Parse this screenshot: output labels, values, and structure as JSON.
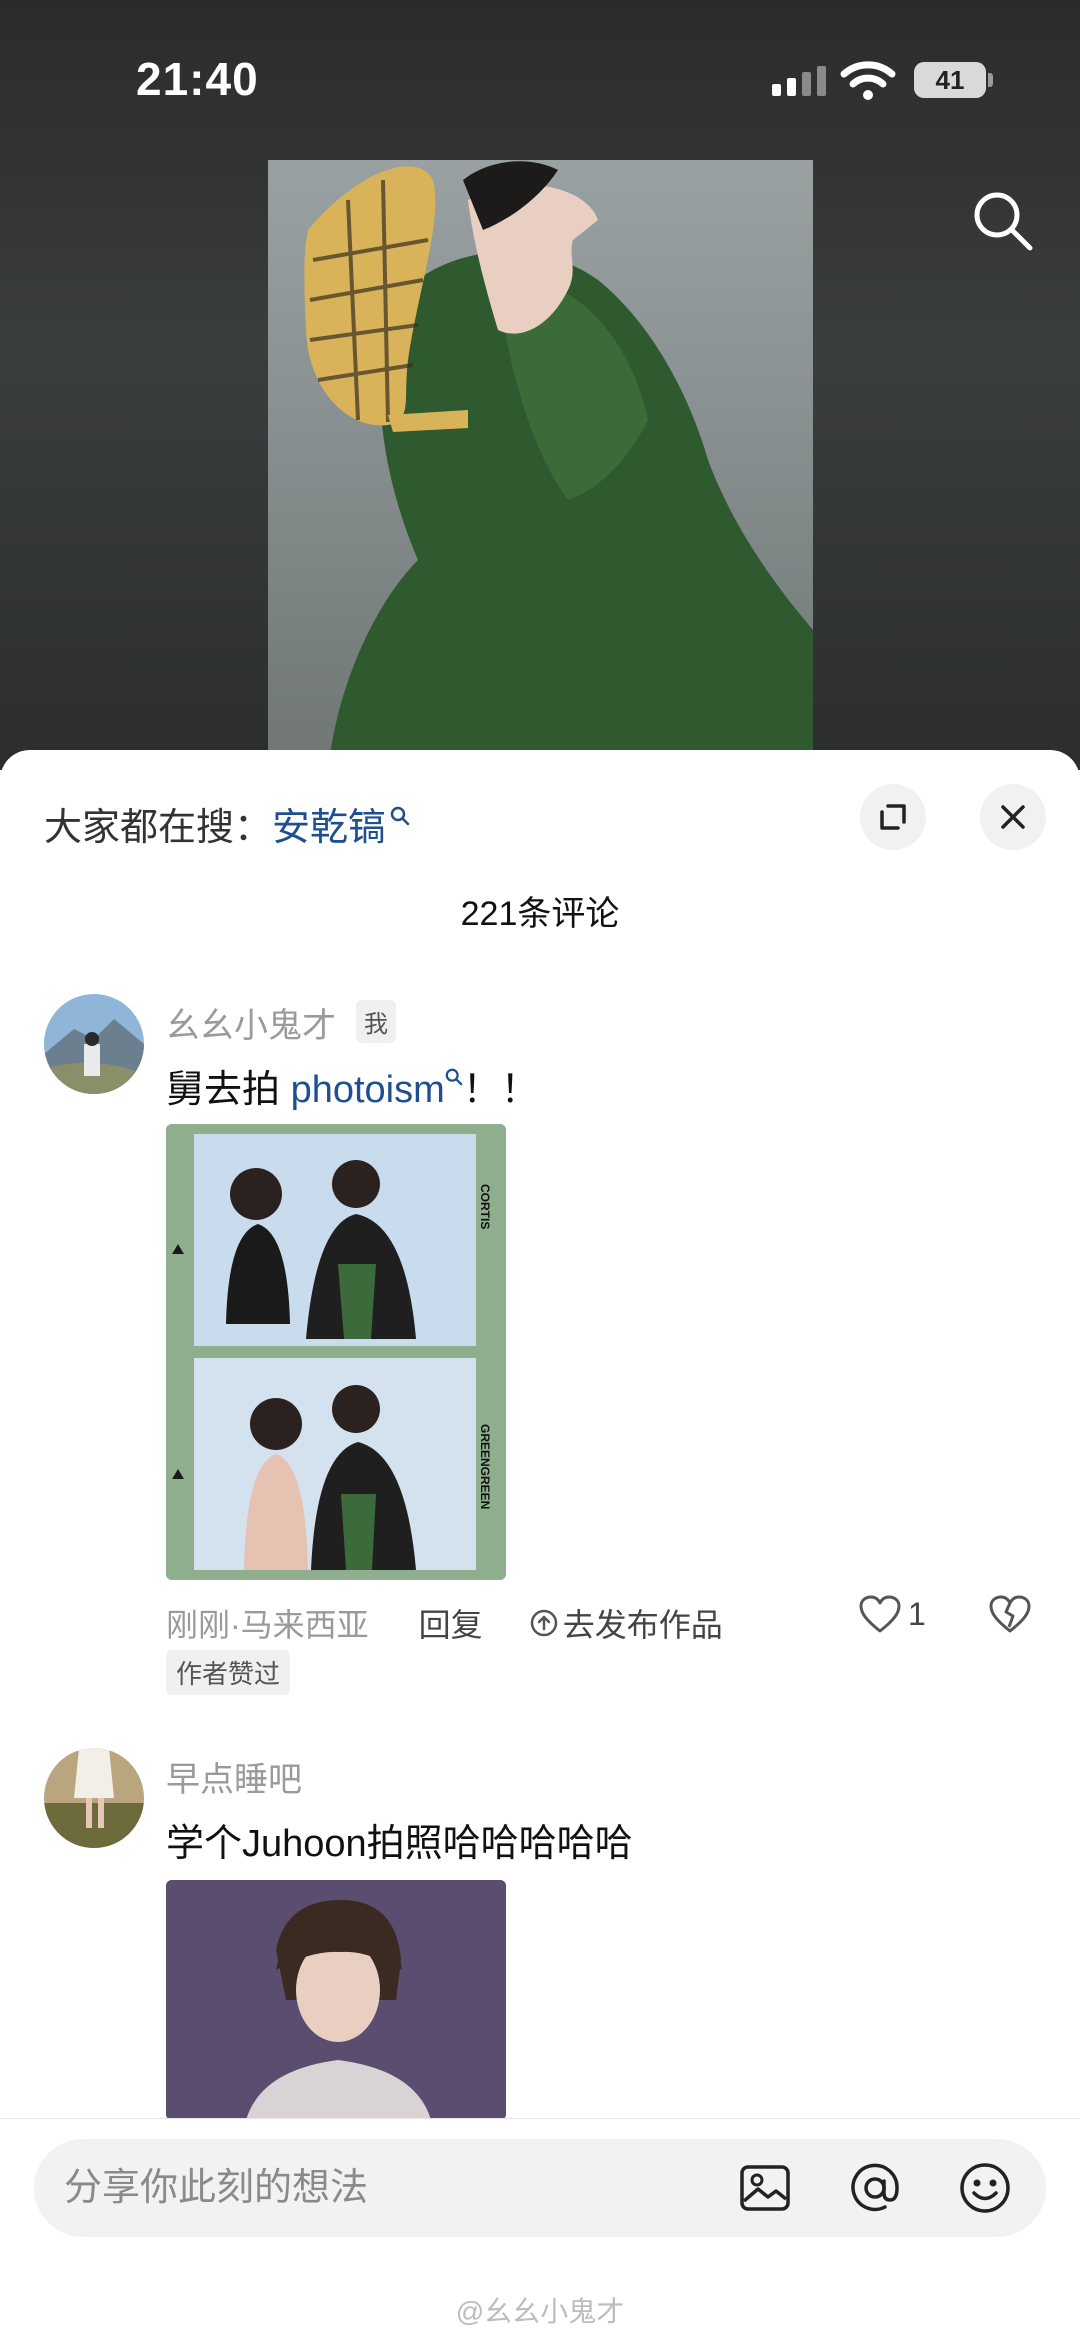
{
  "status_bar": {
    "time": "21:40",
    "battery": "41"
  },
  "sheet": {
    "trending_prefix": "大家都在搜：",
    "trending_keyword": "安乾镐",
    "comment_count": "221条评论"
  },
  "comments": [
    {
      "username": "幺幺小鬼才",
      "badge": "我",
      "text_prefix": "舅去拍 ",
      "text_keyword": "photoism",
      "text_suffix": "！！",
      "time_location": "刚刚·马来西亚",
      "reply_label": "回复",
      "publish_label": "去发布作品",
      "like_count": "1",
      "author_badge": "作者赞过",
      "strip_label_top": "CORTIS",
      "strip_label_bottom": "GREENGREEN"
    },
    {
      "username": "早点睡吧",
      "text": "学个Juhoon拍照哈哈哈哈哈"
    }
  ],
  "input": {
    "placeholder": "分享你此刻的想法"
  },
  "watermark": "@幺幺小鬼才",
  "colors": {
    "keyword": "#1e4f8f",
    "jacket": "#2f5a2f",
    "strip": "#8fae8e"
  }
}
